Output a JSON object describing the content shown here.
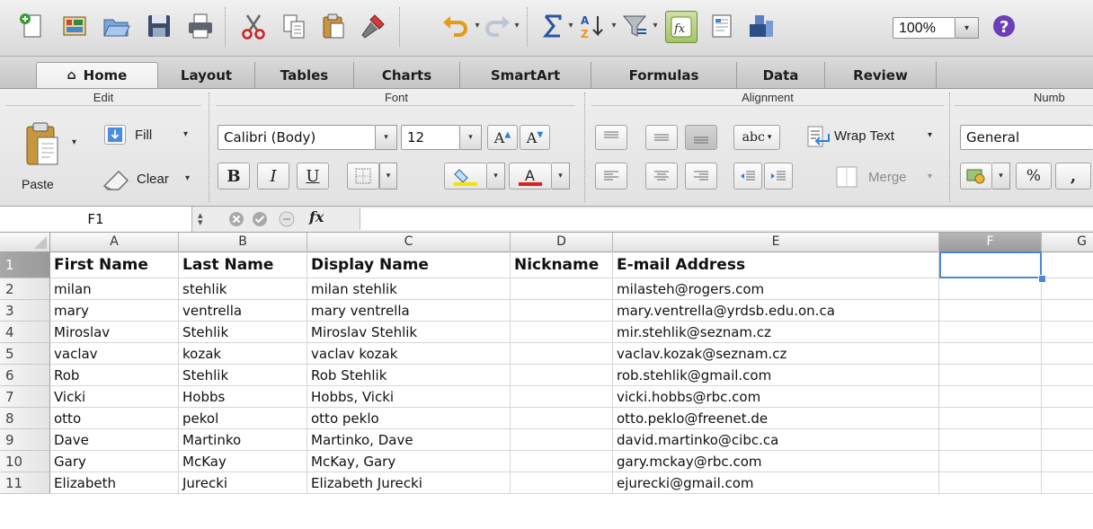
{
  "toolbar": {
    "zoom": "100%"
  },
  "tabs": [
    {
      "label": "Home",
      "active": true
    },
    {
      "label": "Layout"
    },
    {
      "label": "Tables"
    },
    {
      "label": "Charts"
    },
    {
      "label": "SmartArt"
    },
    {
      "label": "Formulas"
    },
    {
      "label": "Data"
    },
    {
      "label": "Review"
    }
  ],
  "ribbon": {
    "groups": {
      "edit": "Edit",
      "font": "Font",
      "alignment": "Alignment",
      "number": "Numb"
    },
    "paste_label": "Paste",
    "fill_label": "Fill",
    "clear_label": "Clear",
    "font_name": "Calibri (Body)",
    "font_size": "12",
    "bold": "B",
    "italic": "I",
    "underline": "U",
    "wrap_text": "Wrap Text",
    "merge": "Merge",
    "abc": "abc",
    "number_format": "General",
    "percent": "%",
    "comma": ","
  },
  "formula_bar": {
    "name_box": "F1",
    "fx": "fx"
  },
  "grid": {
    "columns": [
      "A",
      "B",
      "C",
      "D",
      "E",
      "F",
      "G"
    ],
    "selected_column": "F",
    "selected_cell": "F1",
    "rows": [
      {
        "num": "1",
        "cells": [
          "First Name",
          "Last Name",
          "Display Name",
          "Nickname",
          "E-mail Address"
        ]
      },
      {
        "num": "2",
        "cells": [
          "milan",
          "stehlik",
          "milan stehlik",
          "",
          "milasteh@rogers.com"
        ]
      },
      {
        "num": "3",
        "cells": [
          "mary",
          "ventrella",
          "mary ventrella",
          "",
          "mary.ventrella@yrdsb.edu.on.ca"
        ]
      },
      {
        "num": "4",
        "cells": [
          "Miroslav",
          "Stehlik",
          "Miroslav Stehlik",
          "",
          "mir.stehlik@seznam.cz"
        ]
      },
      {
        "num": "5",
        "cells": [
          "vaclav",
          "kozak",
          "vaclav kozak",
          "",
          "vaclav.kozak@seznam.cz"
        ]
      },
      {
        "num": "6",
        "cells": [
          "Rob",
          "Stehlik",
          "Rob Stehlik",
          "",
          "rob.stehlik@gmail.com"
        ]
      },
      {
        "num": "7",
        "cells": [
          "Vicki",
          "Hobbs",
          "Hobbs, Vicki",
          "",
          "vicki.hobbs@rbc.com"
        ]
      },
      {
        "num": "8",
        "cells": [
          "otto",
          "pekol",
          "otto peklo",
          "",
          "otto.peklo@freenet.de"
        ]
      },
      {
        "num": "9",
        "cells": [
          "Dave",
          "Martinko",
          "Martinko, Dave",
          "",
          "david.martinko@cibc.ca"
        ]
      },
      {
        "num": "10",
        "cells": [
          "Gary",
          "McKay",
          "McKay, Gary",
          "",
          "gary.mckay@rbc.com"
        ]
      },
      {
        "num": "11",
        "cells": [
          "Elizabeth",
          "Jurecki",
          "Elizabeth Jurecki",
          "",
          "ejurecki@gmail.com"
        ]
      }
    ]
  },
  "colors": {
    "selection": "#4e86d8",
    "fill_highlight": "#f6e400",
    "font_color": "#e02020",
    "help": "#6a3fb8"
  }
}
